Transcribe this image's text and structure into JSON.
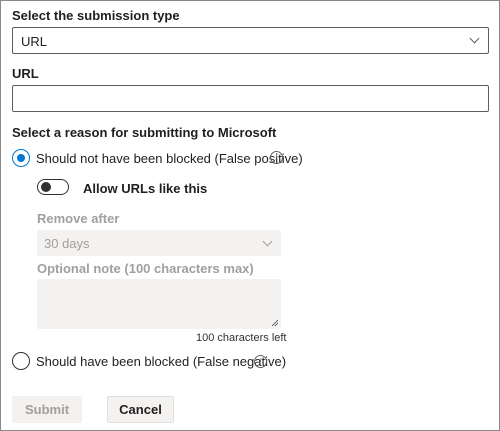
{
  "form": {
    "submission_type_label": "Select the submission type",
    "submission_type_value": "URL",
    "url_label": "URL",
    "url_value": "",
    "reason_label": "Select a reason for submitting to Microsoft",
    "option_false_positive": "Should not have been blocked (False positive)",
    "option_false_positive_selected": true,
    "allow_toggle_label": "Allow URLs like this",
    "allow_toggle_on": false,
    "remove_after_label": "Remove after",
    "remove_after_value": "30 days",
    "note_label": "Optional note (100 characters max)",
    "note_value": "",
    "chars_left": "100 characters left",
    "option_false_negative": "Should have been blocked (False negative)",
    "option_false_negative_selected": false
  },
  "actions": {
    "submit_label": "Submit",
    "cancel_label": "Cancel"
  },
  "colors": {
    "accent": "#0078d4",
    "disabled_text": "#a19f9d",
    "disabled_bg": "#f3f2f1"
  },
  "icons": {
    "info": "info-icon",
    "dropdown": "chevron-down-icon"
  }
}
